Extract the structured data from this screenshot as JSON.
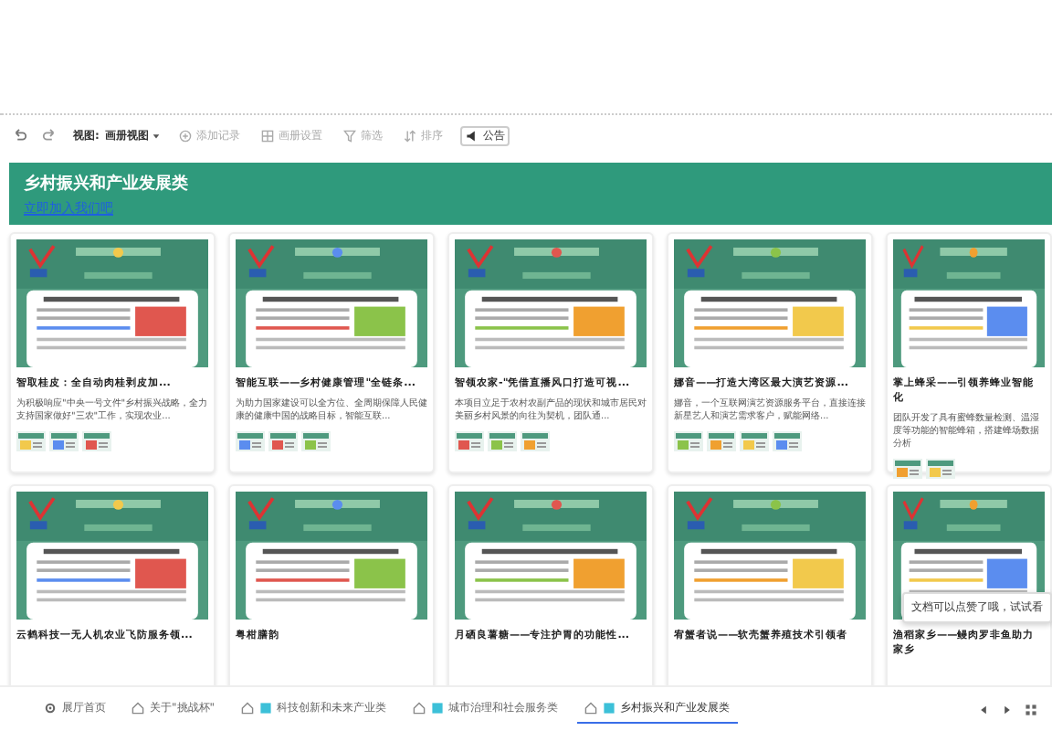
{
  "toolbar": {
    "view_label": "视图:",
    "view_value": "画册视图",
    "actions": [
      {
        "label": "添加记录",
        "kind": "add",
        "disabled": true
      },
      {
        "label": "画册设置",
        "kind": "settings",
        "disabled": true
      },
      {
        "label": "筛选",
        "kind": "filter",
        "disabled": true
      },
      {
        "label": "排序",
        "kind": "sort",
        "disabled": true
      },
      {
        "label": "公告",
        "kind": "notice",
        "disabled": false
      }
    ]
  },
  "header": {
    "title": "乡村振兴和产业发展类",
    "link": "立即加入我们吧"
  },
  "cards": [
    {
      "title": "智取桂皮：全自动肉桂剥皮加...",
      "description": "为积极响应\"中央一号文件\"乡村振兴战略，全力支持国家做好\"三农\"工作，实现农业..."
    },
    {
      "title": "智能互联——乡村健康管理\"全链条...",
      "description": "为助力国家建设可以全方位、全周期保障人民健康的健康中国的战略目标，智能互联..."
    },
    {
      "title": "智领农家-\"凭借直播风口打造可视...",
      "description": "本项目立足于农村农副产品的现状和城市居民对美丽乡村风景的向往为契机，团队通..."
    },
    {
      "title": "娜音——打造大湾区最大演艺资源...",
      "description": "娜音，一个互联网演艺资源服务平台，直接连接新星艺人和演艺需求客户，赋能网络..."
    },
    {
      "title": "掌上蜂采——引领养蜂业智能化",
      "description": "团队开发了具有蜜蜂数量检测、温湿度等功能的智能蜂箱，搭建蜂场数据分析"
    },
    {
      "title": "云鹤科技一无人机农业飞防服务领..."
    },
    {
      "title": "粤柑膳韵"
    },
    {
      "title": "月硒良薯糖——专注护胃的功能性..."
    },
    {
      "title": "宥蟹者说——软壳蟹养殖技术引领者"
    },
    {
      "title": "渔稻家乡——鳗肉罗非鱼助力家乡"
    }
  ],
  "tooltip": {
    "text": "文档可以点赞了哦，试试看"
  },
  "tabs": [
    {
      "label": "展厅首页",
      "kind": "home",
      "selected": false
    },
    {
      "label": "关于\"挑战杯\"",
      "kind": "doc",
      "selected": false
    },
    {
      "label": "科技创新和未来产业类",
      "kind": "gallery",
      "selected": false
    },
    {
      "label": "城市治理和社会服务类",
      "kind": "gallery",
      "selected": false
    },
    {
      "label": "乡村振兴和产业发展类",
      "kind": "gallery",
      "selected": true
    }
  ]
}
